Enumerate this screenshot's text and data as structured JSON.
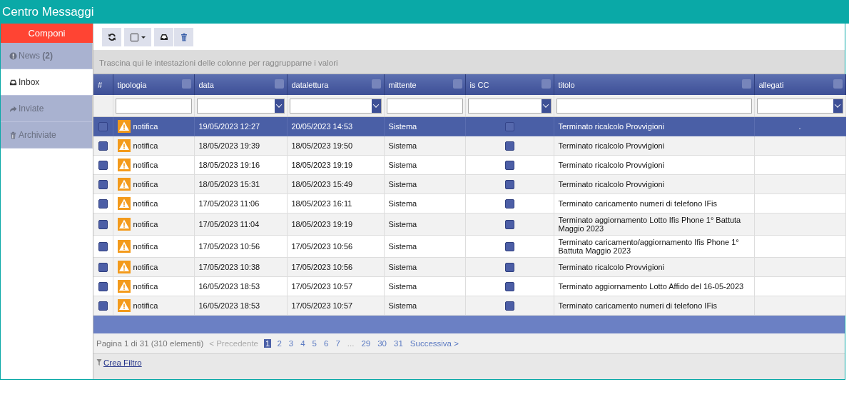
{
  "window": {
    "title": "Centro Messaggi"
  },
  "sidebar": {
    "compose": "Componi",
    "items": [
      {
        "label": "News",
        "count": "(2)",
        "selected": false
      },
      {
        "label": "Inbox",
        "selected": true
      },
      {
        "label": "Inviate",
        "selected": false
      },
      {
        "label": "Archiviate",
        "selected": false
      }
    ]
  },
  "group_panel": "Trascina qui le intestazioni delle colonne per raggrupparne i valori",
  "table": {
    "columns": [
      {
        "label": "#"
      },
      {
        "label": "tipologia",
        "kind": "text"
      },
      {
        "label": "data",
        "kind": "dropdown"
      },
      {
        "label": "datalettura",
        "kind": "dropdown"
      },
      {
        "label": "mittente",
        "kind": "text"
      },
      {
        "label": "is CC",
        "kind": "dropdown"
      },
      {
        "label": "titolo",
        "kind": "text"
      },
      {
        "label": "allegati",
        "kind": "dropdown"
      }
    ],
    "rows": [
      {
        "selected": true,
        "tipologia": "notifica",
        "data": "19/05/2023 12:27",
        "datalettura": "20/05/2023 14:53",
        "mittente": "Sistema",
        "titolo": "Terminato ricalcolo Provvigioni",
        "allegati": "."
      },
      {
        "selected": false,
        "tipologia": "notifica",
        "data": "18/05/2023 19:39",
        "datalettura": "18/05/2023 19:50",
        "mittente": "Sistema",
        "titolo": "Terminato ricalcolo Provvigioni"
      },
      {
        "selected": false,
        "tipologia": "notifica",
        "data": "18/05/2023 19:16",
        "datalettura": "18/05/2023 19:19",
        "mittente": "Sistema",
        "titolo": "Terminato ricalcolo Provvigioni"
      },
      {
        "selected": false,
        "tipologia": "notifica",
        "data": "18/05/2023 15:31",
        "datalettura": "18/05/2023 15:49",
        "mittente": "Sistema",
        "titolo": "Terminato ricalcolo Provvigioni"
      },
      {
        "selected": false,
        "tipologia": "notifica",
        "data": "17/05/2023 11:06",
        "datalettura": "18/05/2023 16:11",
        "mittente": "Sistema",
        "titolo": "Terminato caricamento numeri di telefono IFis"
      },
      {
        "selected": false,
        "tipologia": "notifica",
        "data": "17/05/2023 11:04",
        "datalettura": "18/05/2023 19:19",
        "mittente": "Sistema",
        "titolo": "Terminato aggiornamento Lotto Ifis Phone 1° Battuta Maggio 2023"
      },
      {
        "selected": false,
        "tipologia": "notifica",
        "data": "17/05/2023 10:56",
        "datalettura": "17/05/2023 10:56",
        "mittente": "Sistema",
        "titolo": "Terminato caricamento/aggiornamento Ifis Phone 1° Battuta Maggio 2023"
      },
      {
        "selected": false,
        "tipologia": "notifica",
        "data": "17/05/2023 10:38",
        "datalettura": "17/05/2023 10:56",
        "mittente": "Sistema",
        "titolo": "Terminato ricalcolo Provvigioni"
      },
      {
        "selected": false,
        "tipologia": "notifica",
        "data": "16/05/2023 18:53",
        "datalettura": "17/05/2023 10:57",
        "mittente": "Sistema",
        "titolo": "Terminato aggiornamento Lotto Affido del 16-05-2023"
      },
      {
        "selected": false,
        "tipologia": "notifica",
        "data": "16/05/2023 18:53",
        "datalettura": "17/05/2023 10:57",
        "mittente": "Sistema",
        "titolo": "Terminato caricamento numeri di telefono IFis"
      }
    ]
  },
  "pager": {
    "summary": "Pagina 1 di 31 (310 elementi)",
    "prev": "< Precedente",
    "pages": [
      {
        "label": "1",
        "selected": true
      },
      {
        "label": "2",
        "selected": false
      },
      {
        "label": "3",
        "selected": false
      },
      {
        "label": "4",
        "selected": false
      },
      {
        "label": "5",
        "selected": false
      },
      {
        "label": "6",
        "selected": false
      },
      {
        "label": "7",
        "selected": false
      },
      {
        "label": "...",
        "kind": "ellipsis",
        "selected": false
      },
      {
        "label": "29",
        "selected": false
      },
      {
        "label": "30",
        "selected": false
      },
      {
        "label": "31",
        "selected": false
      }
    ],
    "next": "Successiva >"
  },
  "filter_link": "Crea Filtro"
}
